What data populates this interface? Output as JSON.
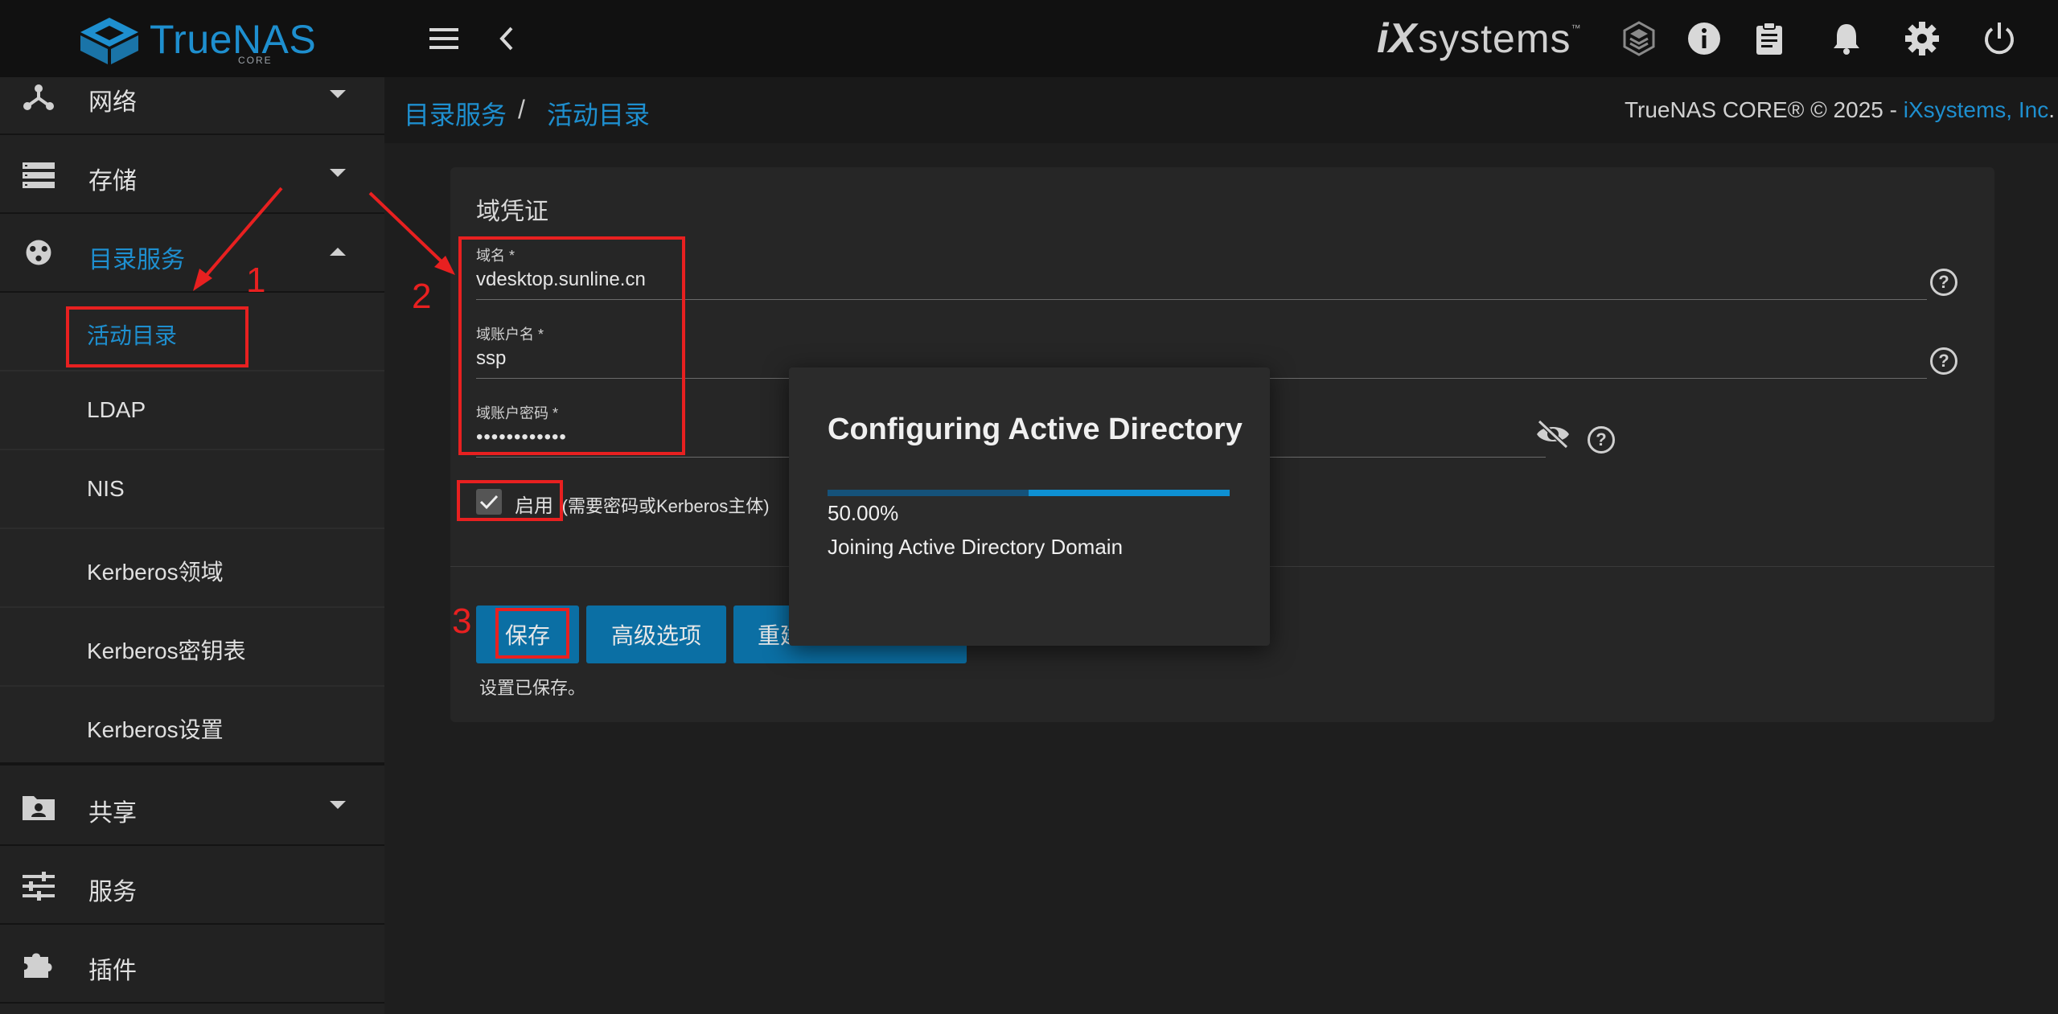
{
  "app": {
    "brand": "TrueNAS",
    "brand_sub": "CORE",
    "vendor_ix": "iX",
    "vendor_systems": "systems",
    "vendor_tm": "™"
  },
  "topbar": {
    "icons": [
      "menu-icon",
      "back-icon",
      "truecommand-icon",
      "info-icon",
      "clipboard-icon",
      "bell-icon",
      "gear-icon",
      "power-icon"
    ]
  },
  "sidebar": {
    "items": [
      {
        "label": "网络",
        "icon": "network-icon",
        "expanded": false
      },
      {
        "label": "存储",
        "icon": "storage-icon",
        "expanded": false
      },
      {
        "label": "目录服务",
        "icon": "directory-icon",
        "expanded": true,
        "active": true
      }
    ],
    "sub_items": [
      {
        "label": "活动目录",
        "active": true
      },
      {
        "label": "LDAP"
      },
      {
        "label": "NIS"
      },
      {
        "label": "Kerberos领域"
      },
      {
        "label": "Kerberos密钥表"
      },
      {
        "label": "Kerberos设置"
      }
    ],
    "items_after": [
      {
        "label": "共享",
        "icon": "share-icon",
        "expanded": false
      },
      {
        "label": "服务",
        "icon": "services-icon"
      },
      {
        "label": "插件",
        "icon": "plugin-icon"
      }
    ]
  },
  "breadcrumb": {
    "parent": "目录服务",
    "separator": "/",
    "current": "活动目录"
  },
  "copyright": {
    "text": "TrueNAS CORE® © 2025 - ",
    "link": "iXsystems, Inc",
    "end": "."
  },
  "form": {
    "section_title": "域凭证",
    "domain_name": {
      "label": "域名 *",
      "value": "vdesktop.sunline.cn"
    },
    "account_name": {
      "label": "域账户名 *",
      "value": "ssp"
    },
    "account_password": {
      "label": "域账户密码 *",
      "value": "••••••••••••"
    },
    "enable": {
      "label": "启用",
      "hint": "(需要密码或Kerberos主体)",
      "checked": true
    },
    "buttons": {
      "save": "保存",
      "advanced": "高级选项",
      "rebuild": "重建"
    },
    "saved_message": "设置已保存。"
  },
  "dialog": {
    "title": "Configuring Active Directory",
    "progress_percent_text": "50.00%",
    "progress_value": 0.5,
    "message": "Joining Active Directory Domain"
  },
  "annotations": {
    "n1": "1",
    "n2": "2",
    "n3": "3",
    "color": "#e82020"
  },
  "colors": {
    "accent": "#1e8fcf",
    "button": "#0b6fa4",
    "topbar": "#111111",
    "sidebar": "#222222"
  }
}
